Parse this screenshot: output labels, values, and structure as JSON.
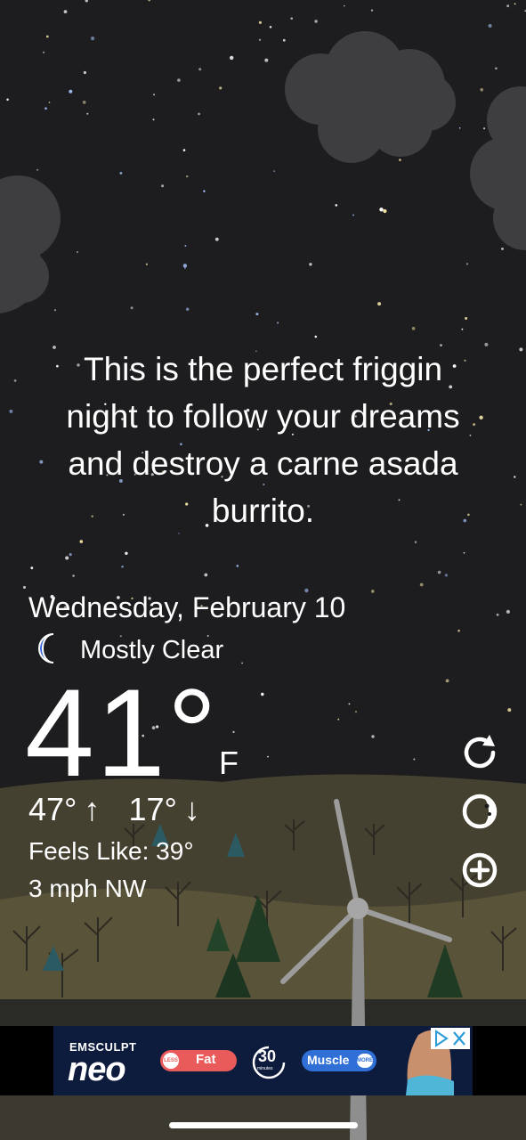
{
  "message": {
    "lines": [
      "This is the perfect friggin",
      "night to follow your dreams",
      "and destroy a carne asada",
      "burrito."
    ]
  },
  "weather": {
    "date": "Wednesday, February 10",
    "condition": "Mostly Clear",
    "condition_icon": "crescent-moon-icon",
    "temperature": "41°",
    "unit": "F",
    "high": "47°",
    "low": "17°",
    "high_arrow": "↑",
    "low_arrow": "↓",
    "feels_like": "Feels Like: 39°",
    "wind": "3 mph NW"
  },
  "actions": [
    {
      "name": "refresh",
      "icon": "refresh-icon"
    },
    {
      "name": "moon-phase",
      "icon": "moon-phase-icon"
    },
    {
      "name": "add-location",
      "icon": "add-icon"
    }
  ],
  "ad": {
    "brand_small": "EMSCULPT",
    "brand_big": "neo",
    "less_badge": "LESS",
    "fat_label": "Fat",
    "minutes_number": "30",
    "minutes_label": "minutes",
    "muscle_label": "Muscle",
    "more_badge": "MORE",
    "adchoices_icon": "adchoices-icon",
    "close_icon": "close-icon"
  },
  "colors": {
    "sky": "#1d1d1f",
    "cloud": "#3e3e40",
    "hill": "#55513a",
    "moon_icon": "#3f6fd8",
    "ad_background": "#0d1b3d"
  }
}
